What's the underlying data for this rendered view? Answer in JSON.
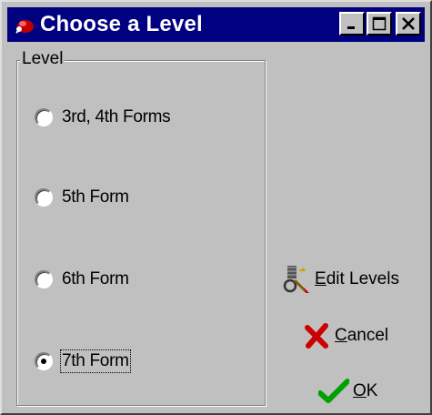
{
  "window": {
    "title": "Choose a Level",
    "title_icon": "app-icon",
    "controls": [
      "minimize",
      "maximize",
      "close"
    ]
  },
  "group": {
    "label": "Level",
    "options": [
      {
        "label": "3rd, 4th Forms",
        "selected": false
      },
      {
        "label": "5th Form",
        "selected": false
      },
      {
        "label": "6th Form",
        "selected": false
      },
      {
        "label": "7th Form",
        "selected": true
      }
    ]
  },
  "buttons": {
    "edit_levels": {
      "mnemonic": "E",
      "rest": "dit Levels",
      "icon": "edit-levels-icon"
    },
    "cancel": {
      "mnemonic": "C",
      "rest": "ancel",
      "icon": "red-x-icon"
    },
    "ok": {
      "mnemonic": "O",
      "rest": "K",
      "icon": "green-check-icon"
    }
  },
  "colors": {
    "titlebar": "#000080",
    "face": "#c0c0c0",
    "cancel_icon": "#cc0000",
    "ok_icon": "#00a000"
  }
}
